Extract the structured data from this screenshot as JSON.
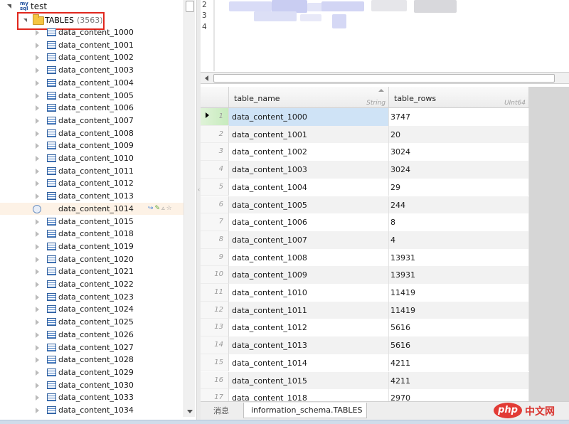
{
  "tree": {
    "database": "test",
    "db_icon_text": [
      "my",
      "sql"
    ],
    "tables_folder": {
      "label": "TABLES",
      "count": "(3563)"
    },
    "tables": [
      "data_content_1000",
      "data_content_1001",
      "data_content_1002",
      "data_content_1003",
      "data_content_1004",
      "data_content_1005",
      "data_content_1006",
      "data_content_1007",
      "data_content_1008",
      "data_content_1009",
      "data_content_1010",
      "data_content_1011",
      "data_content_1012",
      "data_content_1013",
      "data_content_1014",
      "data_content_1015",
      "data_content_1018",
      "data_content_1019",
      "data_content_1020",
      "data_content_1021",
      "data_content_1022",
      "data_content_1023",
      "data_content_1024",
      "data_content_1025",
      "data_content_1026",
      "data_content_1027",
      "data_content_1028",
      "data_content_1029",
      "data_content_1030",
      "data_content_1033",
      "data_content_1034"
    ],
    "highlighted_index": 14
  },
  "editor": {
    "line_numbers": [
      "2",
      "3",
      "4"
    ]
  },
  "grid": {
    "columns": [
      {
        "name": "table_name",
        "type": "String"
      },
      {
        "name": "table_rows",
        "type": "UInt64"
      }
    ],
    "rows": [
      [
        "1",
        "data_content_1000",
        "3747"
      ],
      [
        "2",
        "data_content_1001",
        "20"
      ],
      [
        "3",
        "data_content_1002",
        "3024"
      ],
      [
        "4",
        "data_content_1003",
        "3024"
      ],
      [
        "5",
        "data_content_1004",
        "29"
      ],
      [
        "6",
        "data_content_1005",
        "244"
      ],
      [
        "7",
        "data_content_1006",
        "8"
      ],
      [
        "8",
        "data_content_1007",
        "4"
      ],
      [
        "9",
        "data_content_1008",
        "13931"
      ],
      [
        "10",
        "data_content_1009",
        "13931"
      ],
      [
        "11",
        "data_content_1010",
        "11419"
      ],
      [
        "12",
        "data_content_1011",
        "11419"
      ],
      [
        "13",
        "data_content_1012",
        "5616"
      ],
      [
        "14",
        "data_content_1013",
        "5616"
      ],
      [
        "15",
        "data_content_1014",
        "4211"
      ],
      [
        "16",
        "data_content_1015",
        "4211"
      ],
      [
        "17",
        "data_content_1018",
        "2970"
      ]
    ],
    "active_row": 0
  },
  "tabs": {
    "messages": "消息",
    "result": "information_schema.TABLES"
  },
  "watermark": {
    "brand": "php",
    "site": "中文网"
  },
  "colors": {
    "highlight_box": "#e0271d",
    "selection": "#cfe3f6",
    "folder": "#f5c542"
  }
}
